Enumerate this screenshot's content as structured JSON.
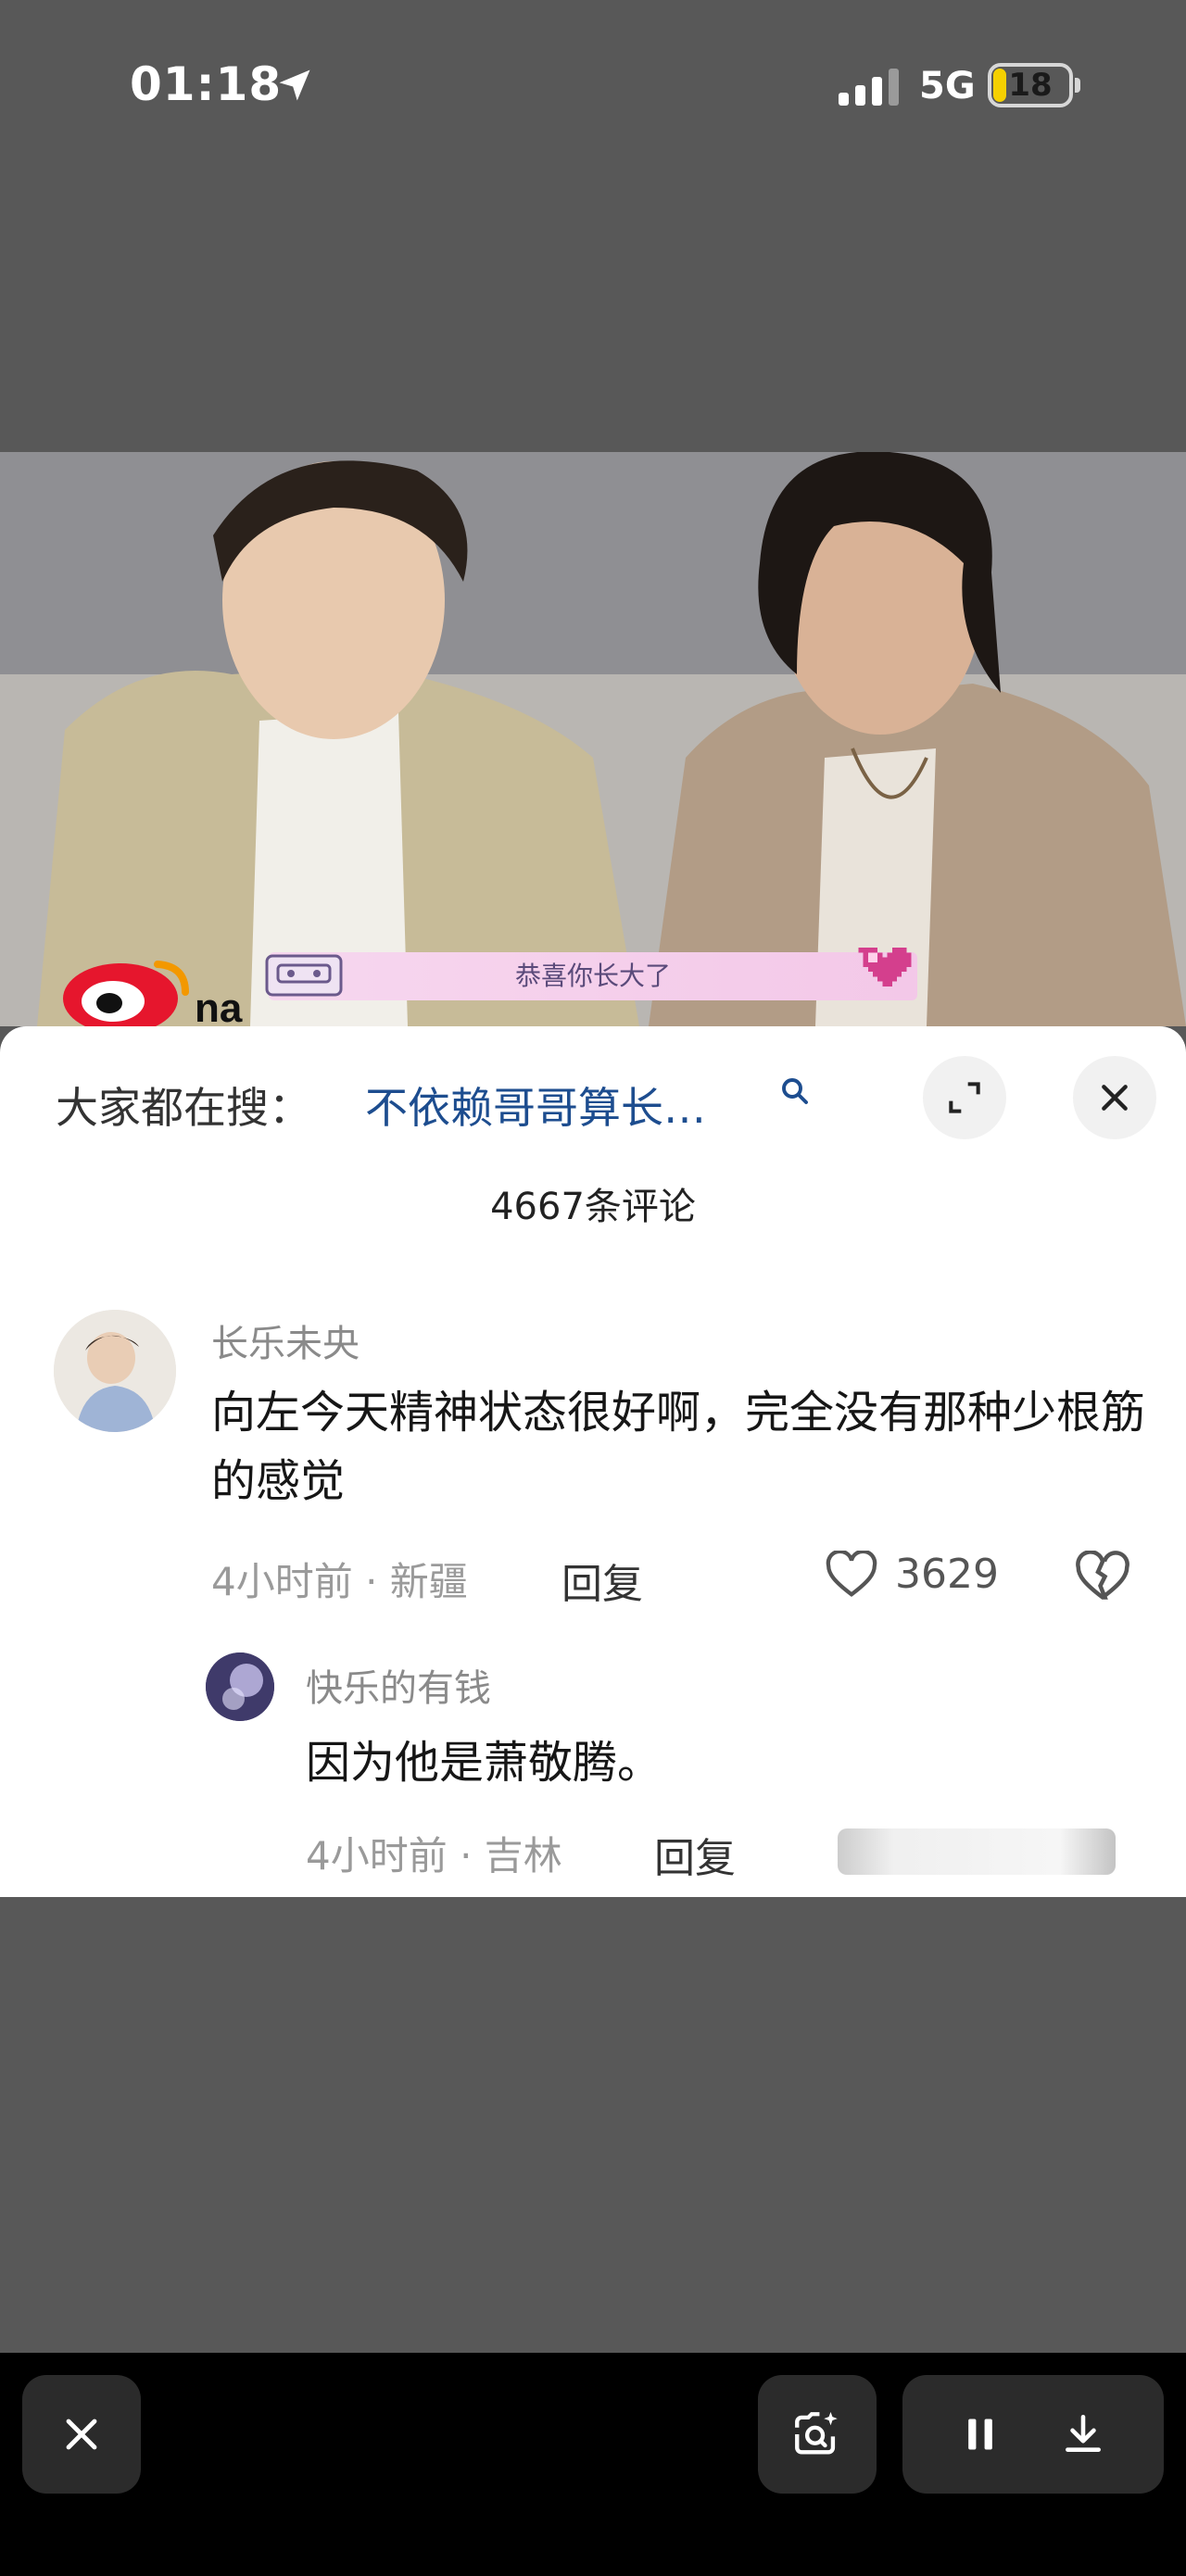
{
  "status_bar": {
    "time": "01:18",
    "network": "5G",
    "battery": "18",
    "icons": [
      "location-arrow-icon",
      "signal-icon",
      "battery-icon"
    ]
  },
  "video": {
    "caption": "恭喜你长大了",
    "logo_icon": "weibo-logo",
    "overlay_icons": [
      "cassette-icon",
      "pixel-heart-icon"
    ]
  },
  "sheet": {
    "search_prefix": "大家都在搜：",
    "search_query": "不依赖哥哥算长…",
    "comments_count": "4667条评论",
    "comments": [
      {
        "user": "长乐未央",
        "text": "向左今天精神状态很好啊，完全没有那种少根筋的感觉",
        "meta": "4小时前 · 新疆",
        "reply_label": "回复",
        "likes": "3629"
      },
      {
        "user": "快乐的有钱",
        "text": "因为他是萧敬腾。",
        "meta": "4小时前 · 吉林",
        "reply_label": "回复"
      }
    ]
  },
  "bottom_bar": {
    "icons": [
      "close-icon",
      "visual-search-icon",
      "pause-icon",
      "download-icon"
    ]
  },
  "colors": {
    "search_query": "#1d4d8f",
    "battery_fill": "#f5d000",
    "backdrop": "#585858"
  }
}
